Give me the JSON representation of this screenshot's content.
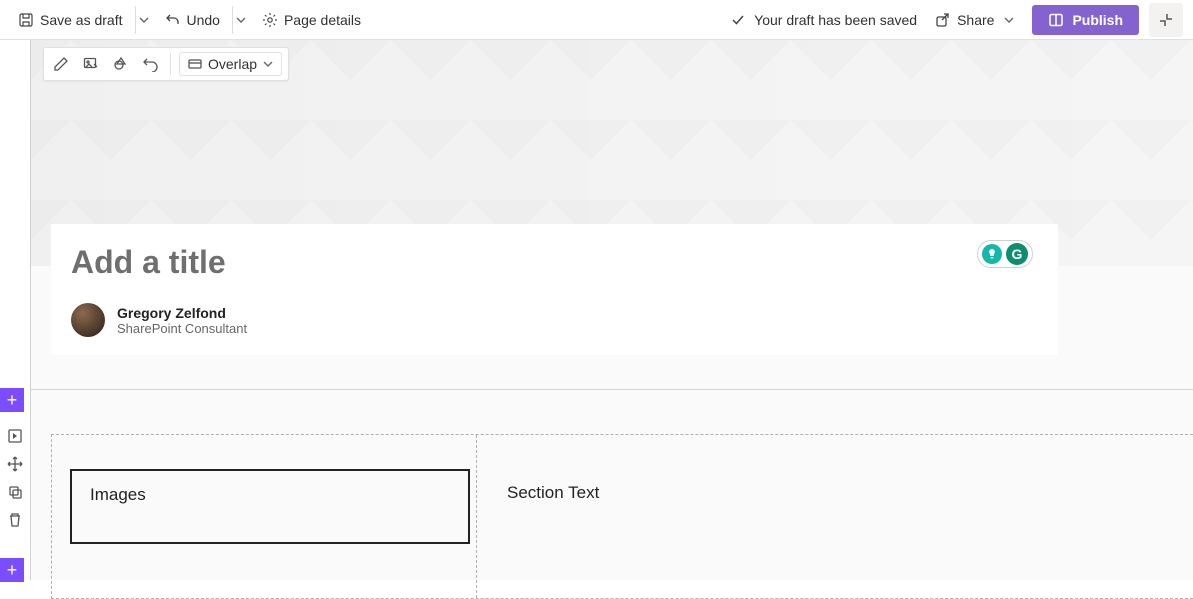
{
  "topbar": {
    "save_as_draft": "Save as draft",
    "undo": "Undo",
    "page_details": "Page details",
    "status": "Your draft has been saved",
    "share": "Share",
    "publish": "Publish"
  },
  "hero_toolbar": {
    "overlap": "Overlap"
  },
  "title": {
    "placeholder": "Add a title"
  },
  "author": {
    "name": "Gregory Zelfond",
    "role": "SharePoint Consultant"
  },
  "section": {
    "col1_label": "Images",
    "col2_label": "Section Text"
  },
  "assist_badge_letter": "G"
}
